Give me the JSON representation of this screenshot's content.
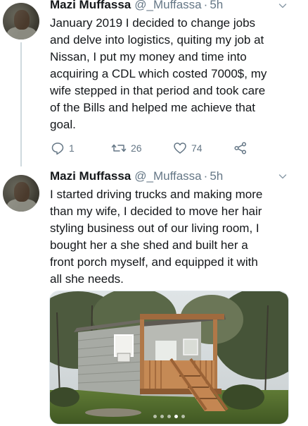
{
  "tweets": [
    {
      "name": "Mazi Muffassa",
      "handle": "@_Muffassa",
      "separator": "·",
      "time": "5h",
      "lines": [
        "January 2019 I decided to change jobs",
        "and delve into logistics, quiting my job at",
        "Nissan, I put my money and time into",
        "acquiring a CDL which costed 7000$, my",
        "wife stepped in that period and took care",
        "of the Bills and helped me achieve that",
        "goal."
      ],
      "replies": "1",
      "retweets": "26",
      "likes": "74"
    },
    {
      "name": "Mazi Muffassa",
      "handle": "@_Muffassa",
      "separator": "·",
      "time": "5h",
      "lines": [
        "I started driving trucks and making more",
        "than my wife, I decided to move her hair",
        "styling business out of our living room, I",
        "bought her a she shed and built her a",
        "front porch myself, and equipped it with",
        "all she needs."
      ],
      "media": {
        "description_icon": "photo",
        "carousel_count": 5,
        "carousel_active": 3
      }
    }
  ],
  "colors": {
    "text": "#14171a",
    "secondary": "#657786",
    "thread_line": "#cfd9de"
  },
  "icons": [
    "reply-icon",
    "retweet-icon",
    "like-icon",
    "share-icon",
    "chevron-down-icon"
  ]
}
